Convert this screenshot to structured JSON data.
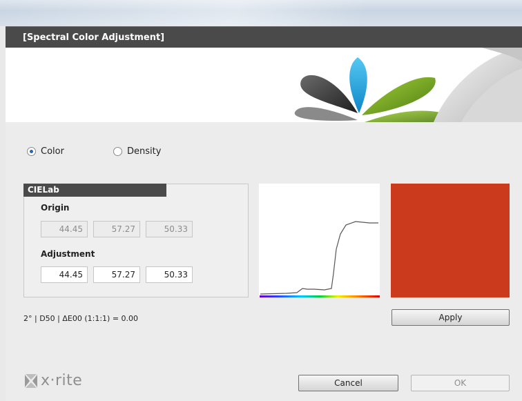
{
  "window": {
    "title": "[Spectral Color Adjustment]"
  },
  "mode": {
    "options": [
      {
        "label": "Color",
        "selected": true
      },
      {
        "label": "Density",
        "selected": false
      }
    ]
  },
  "cielab": {
    "title": "CIELab",
    "origin": {
      "label": "Origin",
      "L": "44.45",
      "a": "57.27",
      "b": "50.33"
    },
    "adjustment": {
      "label": "Adjustment",
      "L": "44.45",
      "a": "57.27",
      "b": "50.33"
    }
  },
  "preview": {
    "swatch_color": "#cb3a1c"
  },
  "status": {
    "text": "2° | D50 | ΔE00 (1:1:1) = 0.00"
  },
  "buttons": {
    "apply": "Apply",
    "cancel": "Cancel",
    "ok": "OK"
  },
  "brand": {
    "logo_text": "x·rite"
  }
}
